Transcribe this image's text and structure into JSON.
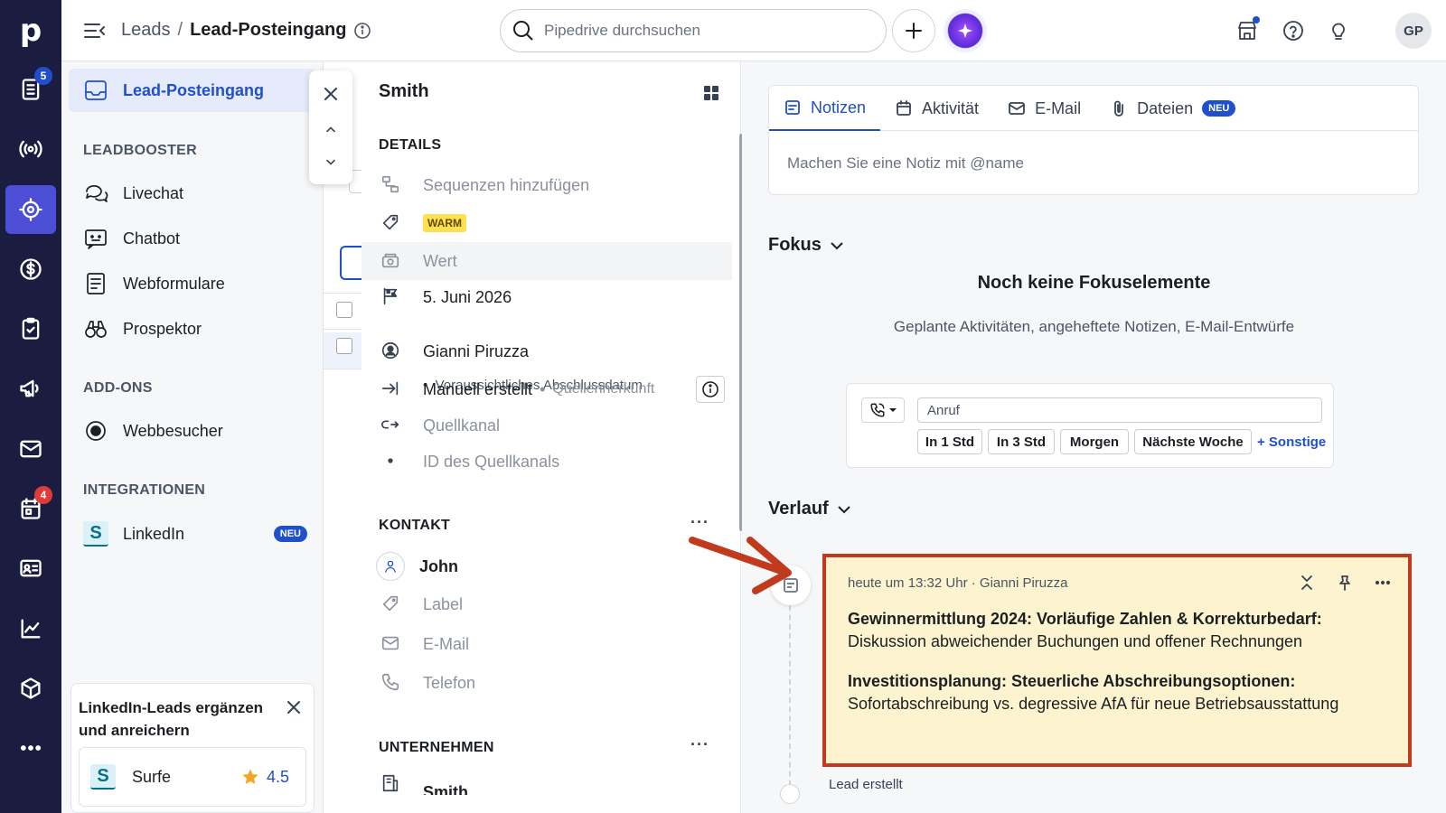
{
  "app": {
    "logo_letter": "p",
    "brand_color": "#1a1d3f",
    "accent_color": "#4c4fd6",
    "link_color": "#1f4fcb"
  },
  "rail": {
    "items": [
      {
        "icon": "leads-inbox-icon",
        "badge": "5",
        "badge_color": "#1f4fcb"
      },
      {
        "icon": "broadcast-icon"
      },
      {
        "icon": "target-icon",
        "active": true
      },
      {
        "icon": "dollar-icon"
      },
      {
        "icon": "clipboard-check-icon"
      },
      {
        "icon": "megaphone-icon"
      },
      {
        "icon": "mail-icon"
      },
      {
        "icon": "calendar-icon",
        "badge": "4",
        "badge_color": "#e03b3b"
      },
      {
        "icon": "contact-card-icon"
      },
      {
        "icon": "chart-icon"
      },
      {
        "icon": "box-icon"
      },
      {
        "icon": "more-icon"
      }
    ]
  },
  "header": {
    "breadcrumb_root": "Leads",
    "breadcrumb_sep": "/",
    "breadcrumb_current": "Lead-Posteingang",
    "search_placeholder": "Pipedrive durchsuchen",
    "avatar_initials": "GP"
  },
  "sidebar": {
    "active_item": "Lead-Posteingang",
    "section_leadbooster": "LEADBOOSTER",
    "leadbooster_items": [
      "Livechat",
      "Chatbot",
      "Webformulare",
      "Prospektor"
    ],
    "section_addons": "ADD-ONS",
    "addon_items": [
      "Webbesucher"
    ],
    "section_integrations": "INTEGRATIONEN",
    "integration_item": "LinkedIn",
    "integration_badge": "NEU",
    "promo_title": "LinkedIn-Leads ergänzen und anreichern",
    "promo_app": "Surfe",
    "promo_logo_letter": "S",
    "promo_rating": "4.5"
  },
  "details": {
    "title": "Smith",
    "section_details": "DETAILS",
    "sequences": "Sequenzen hinzufügen",
    "label_badge": "WARM",
    "value_placeholder": "Wert",
    "close_date": "5. Juni 2026",
    "close_date_note": "Voraussichtliches Abschlussdatum",
    "owner": "Gianni Piruzza",
    "source_origin": "Manuell erstellt",
    "source_origin_label": "Quellenherkunft",
    "source_channel": "Quellkanal",
    "source_channel_id": "ID des Quellkanals",
    "section_contact": "KONTAKT",
    "contact_name": "John",
    "contact_label": "Label",
    "contact_email": "E-Mail",
    "contact_phone": "Telefon",
    "section_company": "UNTERNEHMEN",
    "company_name": "Smith"
  },
  "composer": {
    "tabs": [
      "Notizen",
      "Aktivität",
      "E-Mail",
      "Dateien"
    ],
    "tab_new_badge": "NEU",
    "note_placeholder": "Machen Sie eine Notiz mit @name"
  },
  "focus": {
    "heading": "Fokus",
    "empty_title": "Noch keine Fokuselemente",
    "empty_subtitle": "Geplante Aktivitäten, angeheftete Notizen, E-Mail-Entwürfe",
    "call_placeholder": "Anruf",
    "quick_buttons": [
      "In 1 Std",
      "In 3 Std",
      "Morgen",
      "Nächste Woche"
    ],
    "more_link": "+ Sonstige"
  },
  "history": {
    "heading": "Verlauf",
    "note_meta": "heute um 13:32 Uhr · Gianni Piruzza",
    "note_p1_bold": "Gewinnermittlung 2024: Vorläufige Zahlen & Korrekturbedarf:",
    "note_p1_text": " Diskussion abweichender Buchungen und offener Rechnungen",
    "note_p2_bold": "Investitionsplanung: Steuerliche Abschreibungsoptionen:",
    "note_p2_text": " Sofortabschreibung vs. degressive AfA für neue Betriebsausstattung",
    "lead_created": "Lead erstellt",
    "highlight_color": "#c23a1e",
    "note_bg": "#fdf4cf"
  }
}
